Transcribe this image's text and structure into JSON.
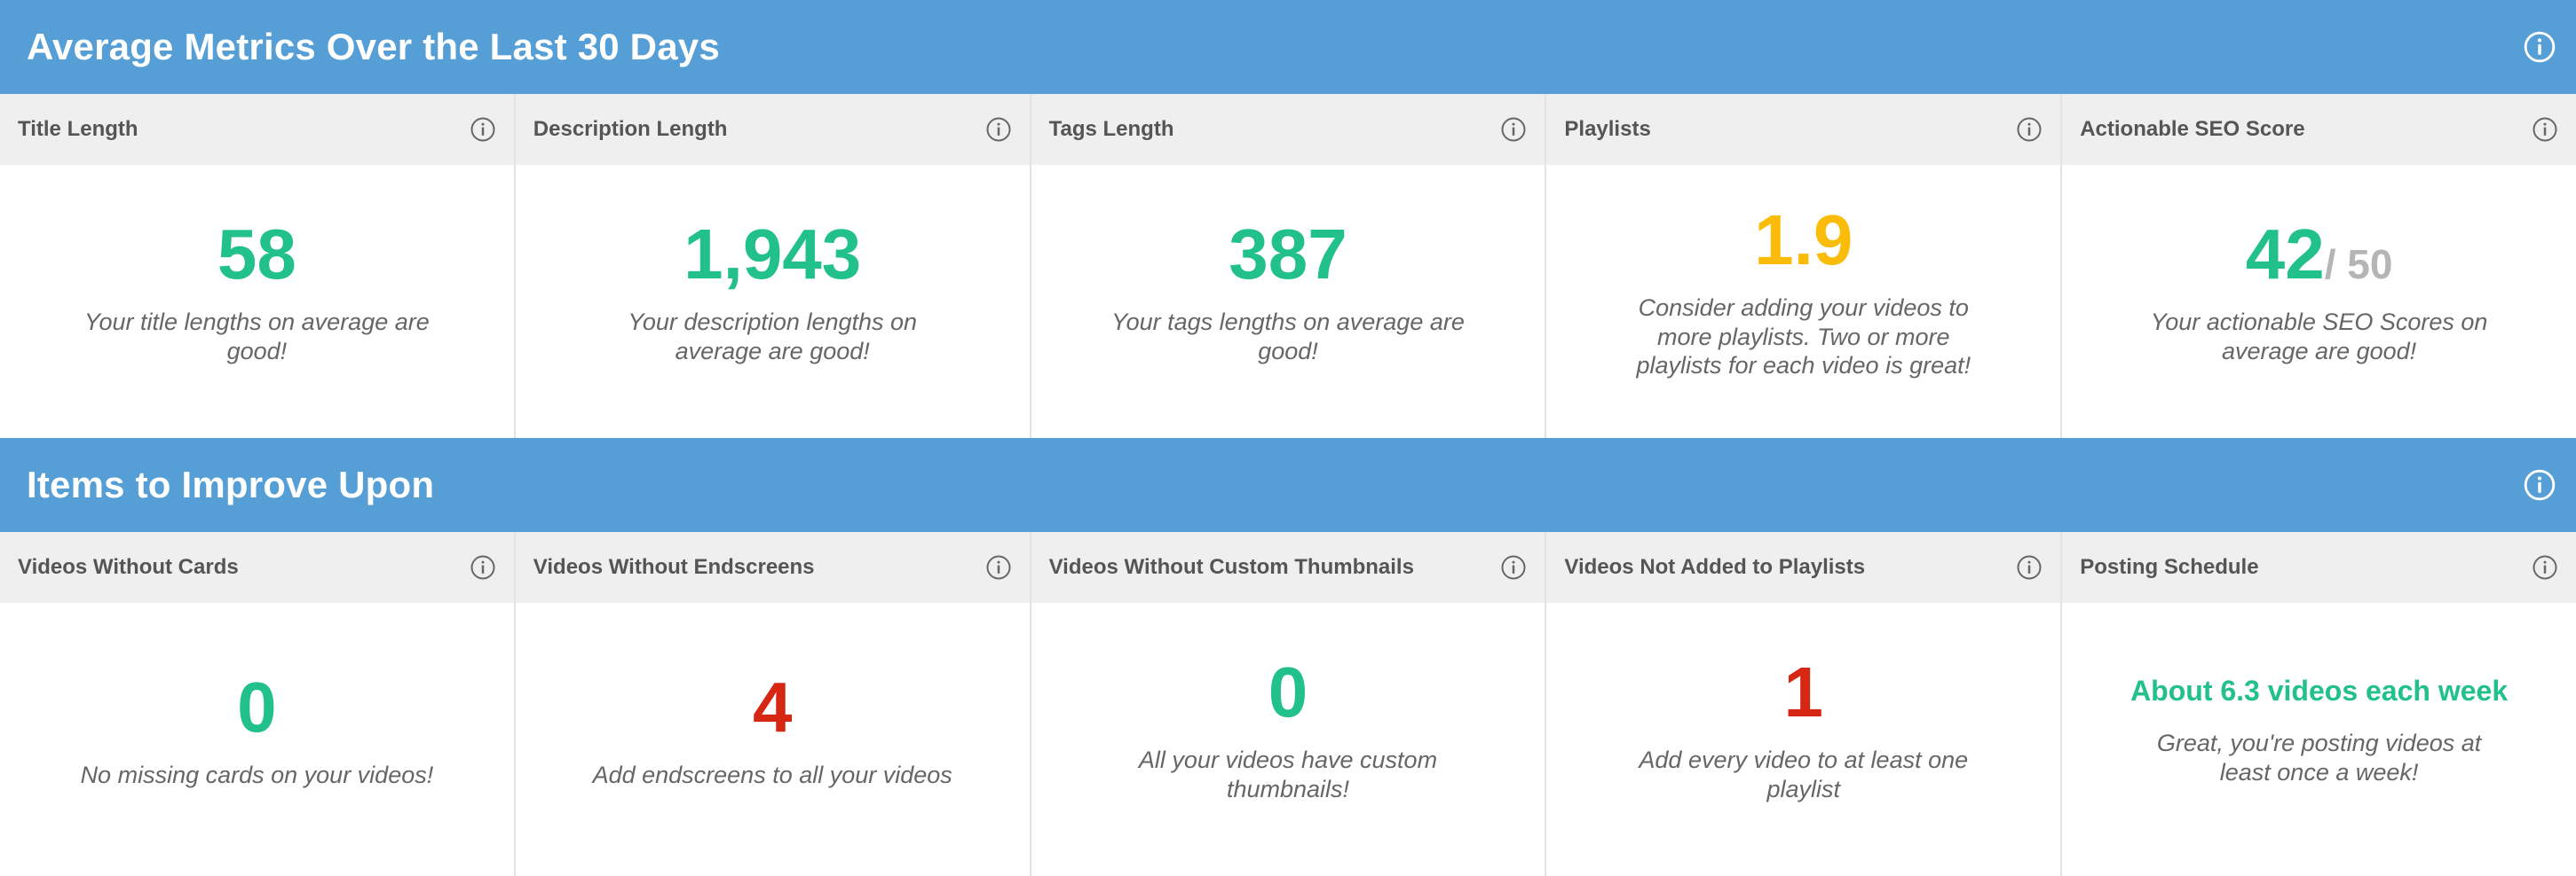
{
  "colors": {
    "header_bg": "#559ed6",
    "good": "#22c08b",
    "warning": "#fbbc09",
    "bad": "#d52713",
    "muted": "#b5b5b5"
  },
  "icons": {
    "info": "info-circle-icon"
  },
  "average_section": {
    "title": "Average Metrics Over the Last 30 Days",
    "cards": [
      {
        "label": "Title Length",
        "value": "58",
        "status": "good",
        "message": "Your title lengths on average are good!"
      },
      {
        "label": "Description Length",
        "value": "1,943",
        "status": "good",
        "message": "Your description lengths on average are good!"
      },
      {
        "label": "Tags Length",
        "value": "387",
        "status": "good",
        "message": "Your tags lengths on average are good!"
      },
      {
        "label": "Playlists",
        "value": "1.9",
        "status": "warning",
        "message": "Consider adding your videos to more playlists. Two or more playlists for each video is great!"
      },
      {
        "label": "Actionable SEO Score",
        "value": "42",
        "suffix": "/ 50",
        "status": "good",
        "message": "Your actionable SEO Scores on average are good!"
      }
    ]
  },
  "improve_section": {
    "title": "Items to Improve Upon",
    "cards": [
      {
        "label": "Videos Without Cards",
        "value": "0",
        "status": "good",
        "message": "No missing cards on your videos!"
      },
      {
        "label": "Videos Without Endscreens",
        "value": "4",
        "status": "bad",
        "message": "Add endscreens to all your videos"
      },
      {
        "label": "Videos Without Custom Thumbnails",
        "value": "0",
        "status": "good",
        "message": "All your videos have custom thumbnails!"
      },
      {
        "label": "Videos Not Added to Playlists",
        "value": "1",
        "status": "bad",
        "message": "Add every video to at least one playlist"
      },
      {
        "label": "Posting Schedule",
        "value": "About 6.3 videos each week",
        "status": "good",
        "message": "Great, you're posting videos at least once a week!"
      }
    ]
  }
}
